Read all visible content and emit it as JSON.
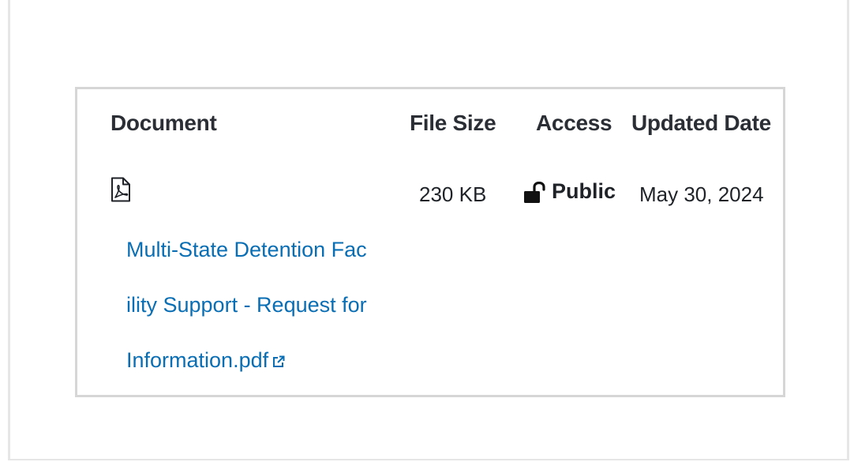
{
  "table": {
    "headers": {
      "document": "Document",
      "file_size": "File Size",
      "access": "Access",
      "updated_date": "Updated Date"
    },
    "rows": [
      {
        "document_icon": "pdf-file-icon",
        "document_link_lines": [
          "Multi-State Detention Fac",
          "ility Support - Request for",
          "Information.pdf"
        ],
        "external_link_icon": "external-link-icon",
        "file_size": "230 KB",
        "access_icon": "unlock-icon",
        "access": "Public",
        "updated_date": "May 30, 2024"
      }
    ]
  },
  "colors": {
    "link": "#0a6eb4",
    "header_text": "#2b2f35",
    "table_border": "#d6d6d6"
  }
}
